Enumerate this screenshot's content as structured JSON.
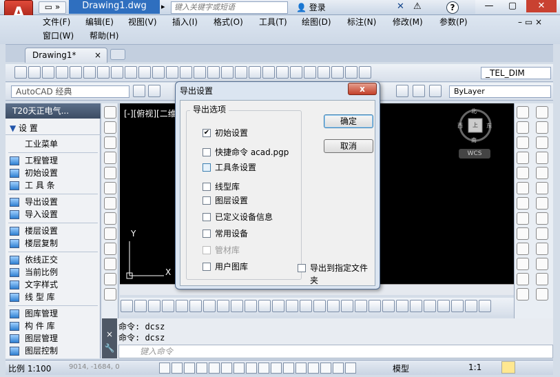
{
  "app": {
    "logo": "A",
    "doc_title": "Drawing1.dwg",
    "search_placeholder": "键入关键字或短语",
    "login": "登录",
    "help": "?"
  },
  "menu": {
    "row1": [
      "文件(F)",
      "编辑(E)",
      "视图(V)",
      "插入(I)",
      "格式(O)",
      "工具(T)",
      "绘图(D)",
      "标注(N)",
      "修改(M)",
      "参数(P)"
    ],
    "row2": [
      "窗口(W)",
      "帮助(H)"
    ]
  },
  "doc_tab": {
    "label": "Drawing1*",
    "close": "×"
  },
  "toolbar": {
    "textstyle": "_TEL_DIM",
    "workspace": "AutoCAD 经典",
    "layer": "ByLayer"
  },
  "palette": {
    "title": "T20天正电气...",
    "section": "设    置",
    "items": [
      {
        "label": "工业菜单"
      },
      {
        "label": "工程管理"
      },
      {
        "label": "初始设置"
      },
      {
        "label": "工 具 条"
      },
      {
        "label": "导出设置"
      },
      {
        "label": "导入设置"
      },
      {
        "label": "楼层设置"
      },
      {
        "label": "楼层复制"
      },
      {
        "label": "依线正交"
      },
      {
        "label": "当前比例"
      },
      {
        "label": "文字样式"
      },
      {
        "label": "线 型 库"
      },
      {
        "label": "图库管理"
      },
      {
        "label": "构 件 库"
      },
      {
        "label": "图层管理"
      },
      {
        "label": "图层控制"
      }
    ]
  },
  "canvas": {
    "viewport_label": "[-][俯视][二维",
    "y_axis": "Y",
    "x_axis": "X",
    "wcs": "WCS",
    "compass": {
      "n": "北",
      "s": "南",
      "e": "东",
      "w": "西",
      "top": "上"
    }
  },
  "command": {
    "history": [
      "命令: dcsz",
      "命令: dcsz"
    ],
    "placeholder": "键入命令",
    "close": "×"
  },
  "status": {
    "scale": "比例 1:100",
    "coords": "9014, -1684, 0",
    "model": "模型",
    "anno_scale": "1:1"
  },
  "dialog": {
    "title": "导出设置",
    "close": "x",
    "group_label": "导出选项",
    "options": [
      {
        "label": "初始设置",
        "checked": true,
        "enabled": true
      },
      {
        "label": "快捷命令 acad.pgp",
        "checked": false,
        "enabled": true
      },
      {
        "label": "工具条设置",
        "checked": false,
        "enabled": true
      },
      {
        "label": "线型库",
        "checked": false,
        "enabled": true
      },
      {
        "label": "图层设置",
        "checked": false,
        "enabled": true
      },
      {
        "label": "已定义设备信息",
        "checked": false,
        "enabled": true
      },
      {
        "label": "常用设备",
        "checked": false,
        "enabled": true
      },
      {
        "label": "管材库",
        "checked": false,
        "enabled": false
      },
      {
        "label": "用户图库",
        "checked": false,
        "enabled": true
      }
    ],
    "export_to_folder": "导出到指定文件夹",
    "ok": "确定",
    "cancel": "取消"
  }
}
